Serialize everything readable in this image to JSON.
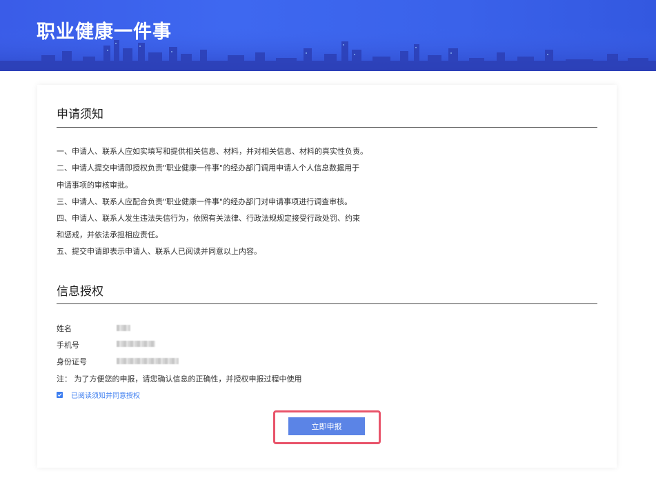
{
  "banner": {
    "title": "职业健康一件事"
  },
  "notice": {
    "title": "申请须知",
    "lines": [
      "一、申请人、联系人应如实填写和提供相关信息、材料，并对相关信息、材料的真实性负责。",
      "二、申请人提交申请即授权负责\"职业健康一件事\"的经办部门调用申请人个人信息数据用于",
      "申请事项的审核审批。",
      "三、申请人、联系人应配合负责\"职业健康一件事\"的经办部门对申请事项进行调查审核。",
      "四、申请人、联系人发生违法失信行为，依照有关法律、行政法规规定接受行政处罚、约束",
      "和惩戒，并依法承担相应责任。",
      "五、提交申请即表示申请人、联系人已阅读并同意以上内容。"
    ]
  },
  "auth": {
    "title": "信息授权",
    "name_label": "姓名",
    "phone_label": "手机号",
    "id_label": "身份证号",
    "note": "注：  为了方便您的申报，请您确认信息的正确性，并授权申报过程中使用",
    "agree_label": "已阅读须知并同意授权",
    "agree_checked": true
  },
  "submit": {
    "label": "立即申报"
  },
  "colors": {
    "banner": "#3a5ce8",
    "accent": "#3d7ef0",
    "button": "#5b84e6",
    "highlight": "#e8546a"
  }
}
